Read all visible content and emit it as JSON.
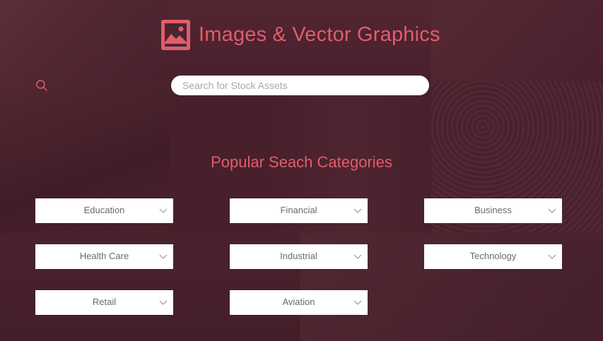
{
  "header": {
    "title": "Images & Vector Graphics",
    "logo_icon": "image-icon"
  },
  "search": {
    "placeholder": "Search for Stock Assets",
    "value": "",
    "icon": "search-icon"
  },
  "categories": {
    "heading": "Popular Seach Categories",
    "items": [
      {
        "label": "Education"
      },
      {
        "label": "Financial"
      },
      {
        "label": "Business"
      },
      {
        "label": "Health Care"
      },
      {
        "label": "Industrial"
      },
      {
        "label": "Technology"
      },
      {
        "label": "Retail"
      },
      {
        "label": "Aviation"
      }
    ]
  },
  "colors": {
    "accent": "#e05d6c",
    "background": "#4a2430",
    "dropdown_bg": "#ffffff",
    "dropdown_text": "#6a6a6a"
  }
}
